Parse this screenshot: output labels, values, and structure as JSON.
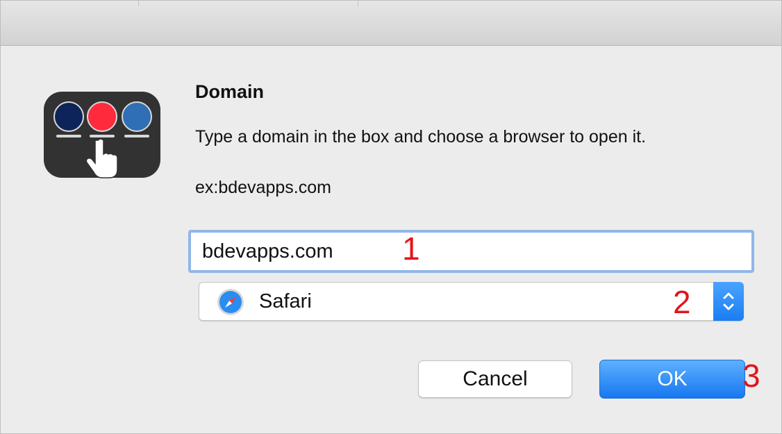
{
  "dialog": {
    "title": "Domain",
    "description": "Type a domain in the box and choose a browser to open it.",
    "example": "ex:bdevapps.com"
  },
  "app_icon": {
    "name": "domain-launcher-icon",
    "dot_colors": [
      "#0c2459",
      "#ff2a3c",
      "#2f6fb5"
    ]
  },
  "domain_input": {
    "value": "bdevapps.com"
  },
  "browser_select": {
    "selected": "Safari",
    "icon": "safari-compass-icon"
  },
  "buttons": {
    "cancel_label": "Cancel",
    "ok_label": "OK"
  },
  "annotations": {
    "marker_1": "1",
    "marker_2": "2",
    "marker_3": "3"
  },
  "colors": {
    "accent": "#1a7ef0",
    "marker": "#e3141b",
    "focus_ring": "#8fb6e8"
  }
}
